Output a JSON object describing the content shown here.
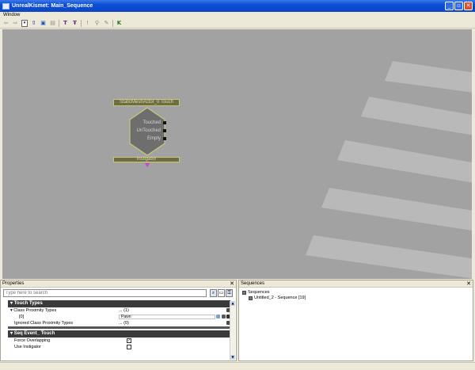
{
  "window": {
    "title": "UnrealKismet: Main_Sequence"
  },
  "menu": {
    "items": [
      "Window"
    ]
  },
  "node": {
    "title": "StaticMeshActor_0 Touch",
    "outputs": [
      "Touched",
      "UnTouched",
      "Empty"
    ],
    "variable": "Instigator"
  },
  "properties": {
    "title": "Properties",
    "search_placeholder": "Type here to search",
    "categories": [
      {
        "label": "Touch Types"
      },
      {
        "label": "Seq Event_ Touch"
      }
    ],
    "rows": {
      "class_proximity": {
        "name": "Class Proximity Types",
        "value": "... (1)"
      },
      "class_proximity_0": {
        "name": "[0]",
        "value": "Pawn"
      },
      "ignored_class": {
        "name": "Ignored Class Proximity Types",
        "value": "... (0)"
      },
      "force_overlapping": {
        "name": "Force Overlapping",
        "checked": "✓"
      },
      "use_instigator": {
        "name": "Use Instigator",
        "checked": ""
      }
    }
  },
  "sequences": {
    "title": "Sequences",
    "root": "Sequences",
    "child": "Untitled_2 - Sequence [19]"
  },
  "colors": {
    "canvas": "#a2a2a2",
    "node_fill": "#6e6e46",
    "node_border": "#c7c779",
    "pin_in": "#d43ad4"
  }
}
